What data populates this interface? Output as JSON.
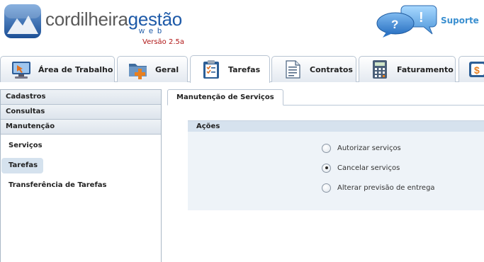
{
  "header": {
    "logo_main": "cordilheira",
    "logo_accent": "gestão",
    "logo_sub": "web",
    "version": "Versão 2.5a",
    "support_label": "Suporte"
  },
  "tabs": [
    {
      "label": "Área de Trabalho",
      "icon": "desktop-icon",
      "active": false
    },
    {
      "label": "Geral",
      "icon": "folder-add-icon",
      "active": false
    },
    {
      "label": "Tarefas",
      "icon": "clipboard-check-icon",
      "active": true
    },
    {
      "label": "Contratos",
      "icon": "document-icon",
      "active": false
    },
    {
      "label": "Faturamento",
      "icon": "calculator-icon",
      "active": false
    },
    {
      "label": "",
      "icon": "money-icon",
      "active": false
    }
  ],
  "sidebar": {
    "sections": [
      "Cadastros",
      "Consultas",
      "Manutenção"
    ],
    "items": [
      {
        "label": "Serviços",
        "selected": false
      },
      {
        "label": "Tarefas",
        "selected": true
      },
      {
        "label": "Transferência de Tarefas",
        "selected": false
      }
    ]
  },
  "main": {
    "tab_label": "Manutenção de Serviços",
    "acoes_title": "Ações",
    "options": [
      {
        "label": "Autorizar serviços",
        "checked": false
      },
      {
        "label": "Cancelar serviços",
        "checked": true
      },
      {
        "label": "Alterar previsão de entrega",
        "checked": false
      }
    ]
  },
  "colors": {
    "brand_blue": "#1e5aa8",
    "version_red": "#b01818",
    "support_blue": "#3a8fd0",
    "panel_bg": "#eef3f8"
  }
}
